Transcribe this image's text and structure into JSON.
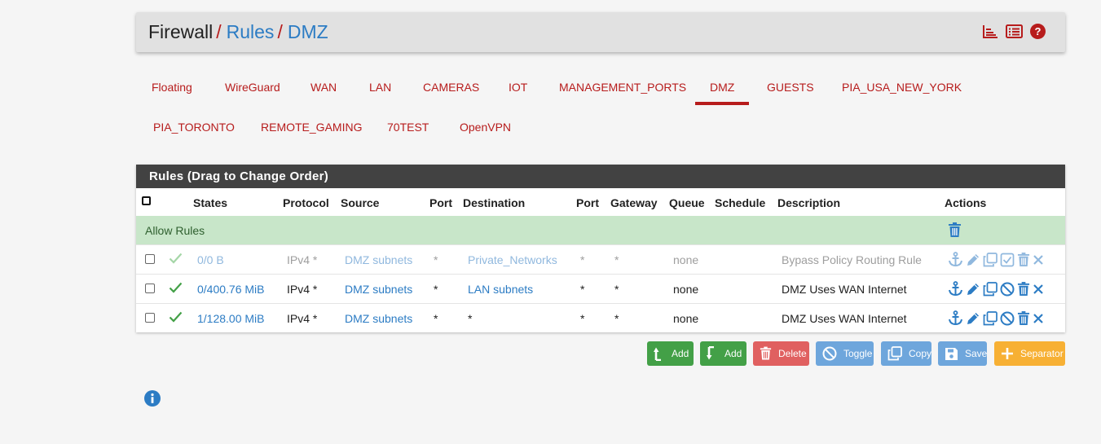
{
  "breadcrumb": {
    "root": "Firewall",
    "sep": "/",
    "level1": "Rules",
    "level2": "DMZ"
  },
  "header_icons": [
    "chart-icon",
    "list-icon",
    "help-icon"
  ],
  "tabs": [
    {
      "label": "Floating"
    },
    {
      "label": "WireGuard"
    },
    {
      "label": "WAN"
    },
    {
      "label": "LAN"
    },
    {
      "label": "CAMERAS"
    },
    {
      "label": "IOT"
    },
    {
      "label": "MANAGEMENT_PORTS"
    },
    {
      "label": "DMZ",
      "active": true
    },
    {
      "label": "GUESTS"
    },
    {
      "label": "PIA_USA_NEW_YORK"
    },
    {
      "label": "PIA_TORONTO"
    },
    {
      "label": "REMOTE_GAMING"
    },
    {
      "label": "70TEST"
    },
    {
      "label": "OpenVPN"
    }
  ],
  "panel": {
    "title": "Rules (Drag to Change Order)",
    "columns": {
      "states": "States",
      "protocol": "Protocol",
      "source": "Source",
      "port": "Port",
      "destination": "Destination",
      "dport": "Port",
      "gateway": "Gateway",
      "queue": "Queue",
      "schedule": "Schedule",
      "description": "Description",
      "actions": "Actions"
    },
    "group_label": "Allow Rules",
    "rows": [
      {
        "states": "0/0 B",
        "protocol": "IPv4 *",
        "source": "DMZ subnets",
        "port": "*",
        "destination": "Private_Networks",
        "dport": "*",
        "gateway": "*",
        "queue": "none",
        "schedule": "",
        "description": "Bypass Policy Routing Rule",
        "disabled": true
      },
      {
        "states": "0/400.76 MiB",
        "protocol": "IPv4 *",
        "source": "DMZ subnets",
        "port": "*",
        "destination": "LAN subnets",
        "dport": "*",
        "gateway": "*",
        "queue": "none",
        "schedule": "",
        "description": "DMZ Uses WAN Internet",
        "disabled": false
      },
      {
        "states": "1/128.00 MiB",
        "protocol": "IPv4 *",
        "source": "DMZ subnets",
        "port": "*",
        "destination": "*",
        "dport": "*",
        "gateway": "*",
        "queue": "none",
        "schedule": "",
        "description": "DMZ Uses WAN Internet",
        "disabled": false
      }
    ]
  },
  "buttons": {
    "add_top": "Add",
    "add_bottom": "Add",
    "delete": "Delete",
    "toggle": "Toggle",
    "copy": "Copy",
    "save": "Save",
    "separator": "Separator"
  },
  "colors": {
    "accent": "#b71c1c",
    "link": "#2c7cc4",
    "success": "#43a047",
    "danger": "#e06060",
    "info": "#6ea6dc",
    "warning": "#f7b034",
    "panel_head": "#424242",
    "group_bg": "#c8e6c9"
  }
}
